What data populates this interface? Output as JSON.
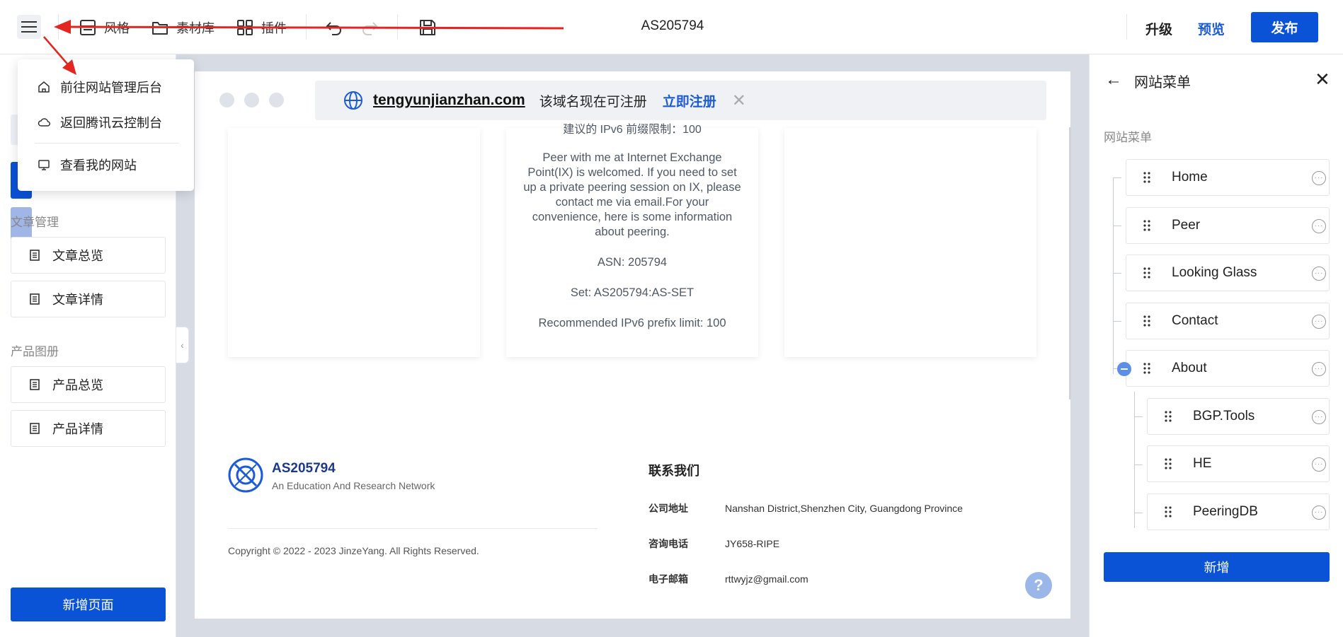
{
  "topbar": {
    "menu_icon": "hamburger-icon",
    "tools": [
      {
        "label": "风格",
        "icon": "layout-icon"
      },
      {
        "label": "素材库",
        "icon": "folder-icon"
      },
      {
        "label": "插件",
        "icon": "grid-icon"
      }
    ],
    "undo_icon": "undo-icon",
    "redo_icon": "redo-icon",
    "save_icon": "save-icon",
    "site_title": "AS205794",
    "upgrade": "升级",
    "preview": "预览",
    "publish": "发布"
  },
  "dropdown": {
    "items": [
      {
        "label": "前往网站管理后台",
        "icon": "home-icon"
      },
      {
        "label": "返回腾讯云控制台",
        "icon": "cloud-icon"
      },
      {
        "label": "查看我的网站",
        "icon": "monitor-icon"
      }
    ]
  },
  "sidebar": {
    "sections": [
      {
        "title": "文章管理",
        "items": [
          "文章总览",
          "文章详情"
        ]
      },
      {
        "title": "产品图册",
        "items": [
          "产品总览",
          "产品详情"
        ]
      }
    ],
    "add_page": "新增页面"
  },
  "canvas": {
    "domain": "tengyunjianzhan.com",
    "domain_msg": "该域名现在可注册",
    "register": "立即注册",
    "clipped_line": "建议的 IPv6 前缀限制：100",
    "card_paragraphs": [
      "Peer with me at Internet Exchange Point(IX) is welcomed. If you need to set up a private peering session on IX, please contact me via email.For your convenience, here is some information about peering.",
      "ASN: 205794",
      "Set: AS205794:AS-SET",
      "Recommended IPv6 prefix limit: 100"
    ],
    "footer": {
      "name": "AS205794",
      "tagline": "An Education And Research Network",
      "copyright": "Copyright © 2022 - 2023 JinzeYang. All Rights Reserved.",
      "contact_title": "联系我们",
      "contacts": [
        {
          "key": "公司地址",
          "value": "Nanshan District,Shenzhen City, Guangdong Province"
        },
        {
          "key": "咨询电话",
          "value": "JY658-RIPE"
        },
        {
          "key": "电子邮箱",
          "value": "rttwyjz@gmail.com"
        }
      ]
    },
    "help": "?"
  },
  "right_panel": {
    "title": "网站菜单",
    "label": "网站菜单",
    "items": [
      {
        "label": "Home",
        "level": 0
      },
      {
        "label": "Peer",
        "level": 0
      },
      {
        "label": "Looking Glass",
        "level": 0
      },
      {
        "label": "Contact",
        "level": 0
      },
      {
        "label": "About",
        "level": 0
      },
      {
        "label": "BGP.Tools",
        "level": 1
      },
      {
        "label": "HE",
        "level": 1
      },
      {
        "label": "PeeringDB",
        "level": 1
      }
    ],
    "add": "新增"
  },
  "colors": {
    "primary": "#0a52d6",
    "link": "#1c5bd8",
    "annotation": "#e3261f"
  }
}
